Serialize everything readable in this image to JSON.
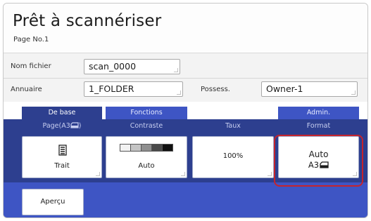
{
  "header": {
    "title": "Prêt à scannériser",
    "page_label": "Page No.1"
  },
  "form": {
    "filename_label": "Nom fichier",
    "filename_value": "scan_0000",
    "directory_label": "Annuaire",
    "directory_value": "1_FOLDER",
    "owner_label": "Possess.",
    "owner_value": "Owner-1"
  },
  "tabs": [
    {
      "label": "De base",
      "active": true
    },
    {
      "label": "Fonctions",
      "active": false
    },
    {
      "label": "Admin.",
      "active": false
    }
  ],
  "settings": {
    "page_header": "Page(A3",
    "page_value": "Trait",
    "contrast_header": "Contraste",
    "contrast_value": "Auto",
    "contrast_levels": [
      "#f2f2f2",
      "#c4c4c4",
      "#8f8f8f",
      "#4a4a4a",
      "#111111"
    ],
    "ratio_header": "Taux",
    "ratio_value": "100%",
    "format_header": "Format",
    "format_value": "Auto",
    "format_size": "A3"
  },
  "actions": {
    "preview_label": "Aperçu"
  },
  "colors": {
    "panel": "#2d3f8f",
    "tab": "#3e55c4",
    "highlight": "#c5242c"
  }
}
